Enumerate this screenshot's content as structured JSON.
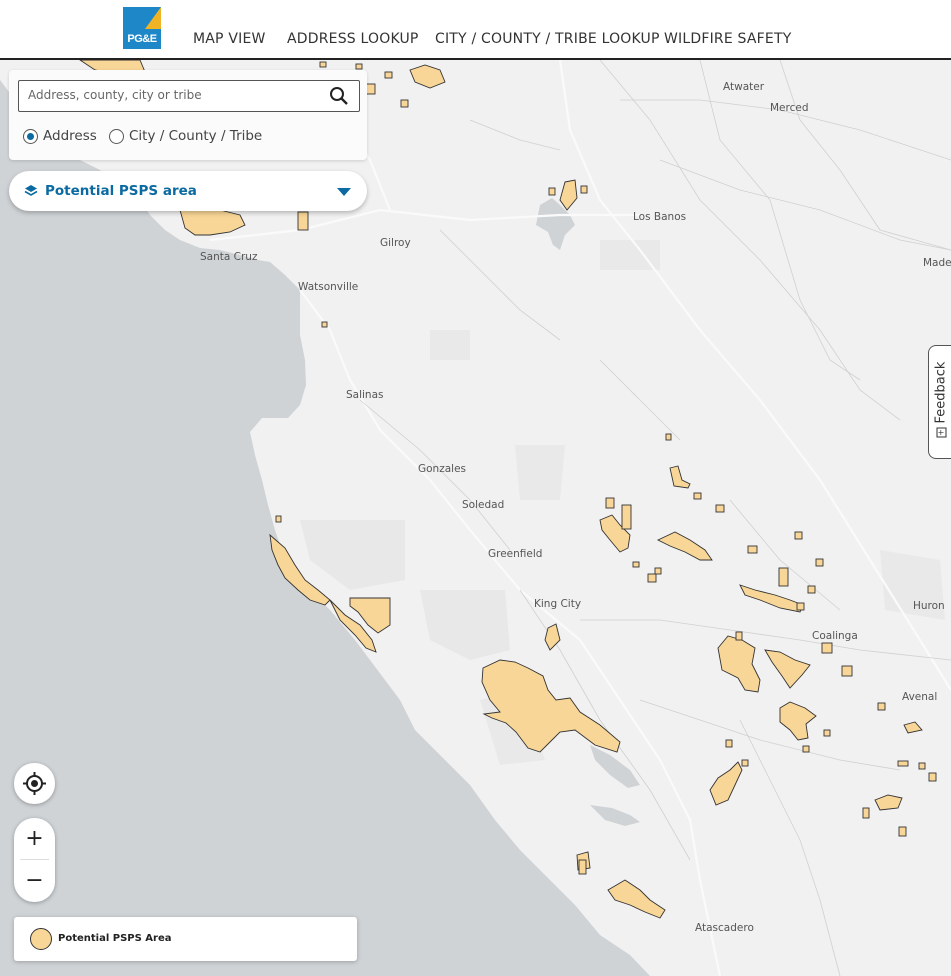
{
  "logo": {
    "text": "PG&E"
  },
  "nav": {
    "map_view": "MAP VIEW",
    "address_lookup": "ADDRESS LOOKUP",
    "city_lookup": "CITY / COUNTY / TRIBE LOOKUP",
    "wildfire_safety": "WILDFIRE SAFETY"
  },
  "search": {
    "placeholder": "Address, county, city or tribe",
    "options": [
      {
        "label": "Address",
        "selected": true
      },
      {
        "label": "City / County / Tribe",
        "selected": false
      }
    ]
  },
  "layer_selector": {
    "label": "Potential PSPS area"
  },
  "feedback": {
    "label": "Feedback"
  },
  "zoom": {
    "in": "+",
    "out": "−"
  },
  "legend": {
    "label": "Potential PSPS Area",
    "color": "#f8d697"
  },
  "colors": {
    "accent": "#0a6aa1",
    "land": "#f1f1f1",
    "ocean": "#cfd3d6",
    "psps_fill": "#f8d697"
  },
  "map": {
    "cities": [
      "Atwater",
      "Merced",
      "Los Banos",
      "Gilroy",
      "Santa Cruz",
      "Made",
      "Watsonville",
      "Salinas",
      "Gonzales",
      "Soledad",
      "Greenfield",
      "King City",
      "Coalinga",
      "Huron",
      "Avenal",
      "Atascadero"
    ]
  }
}
